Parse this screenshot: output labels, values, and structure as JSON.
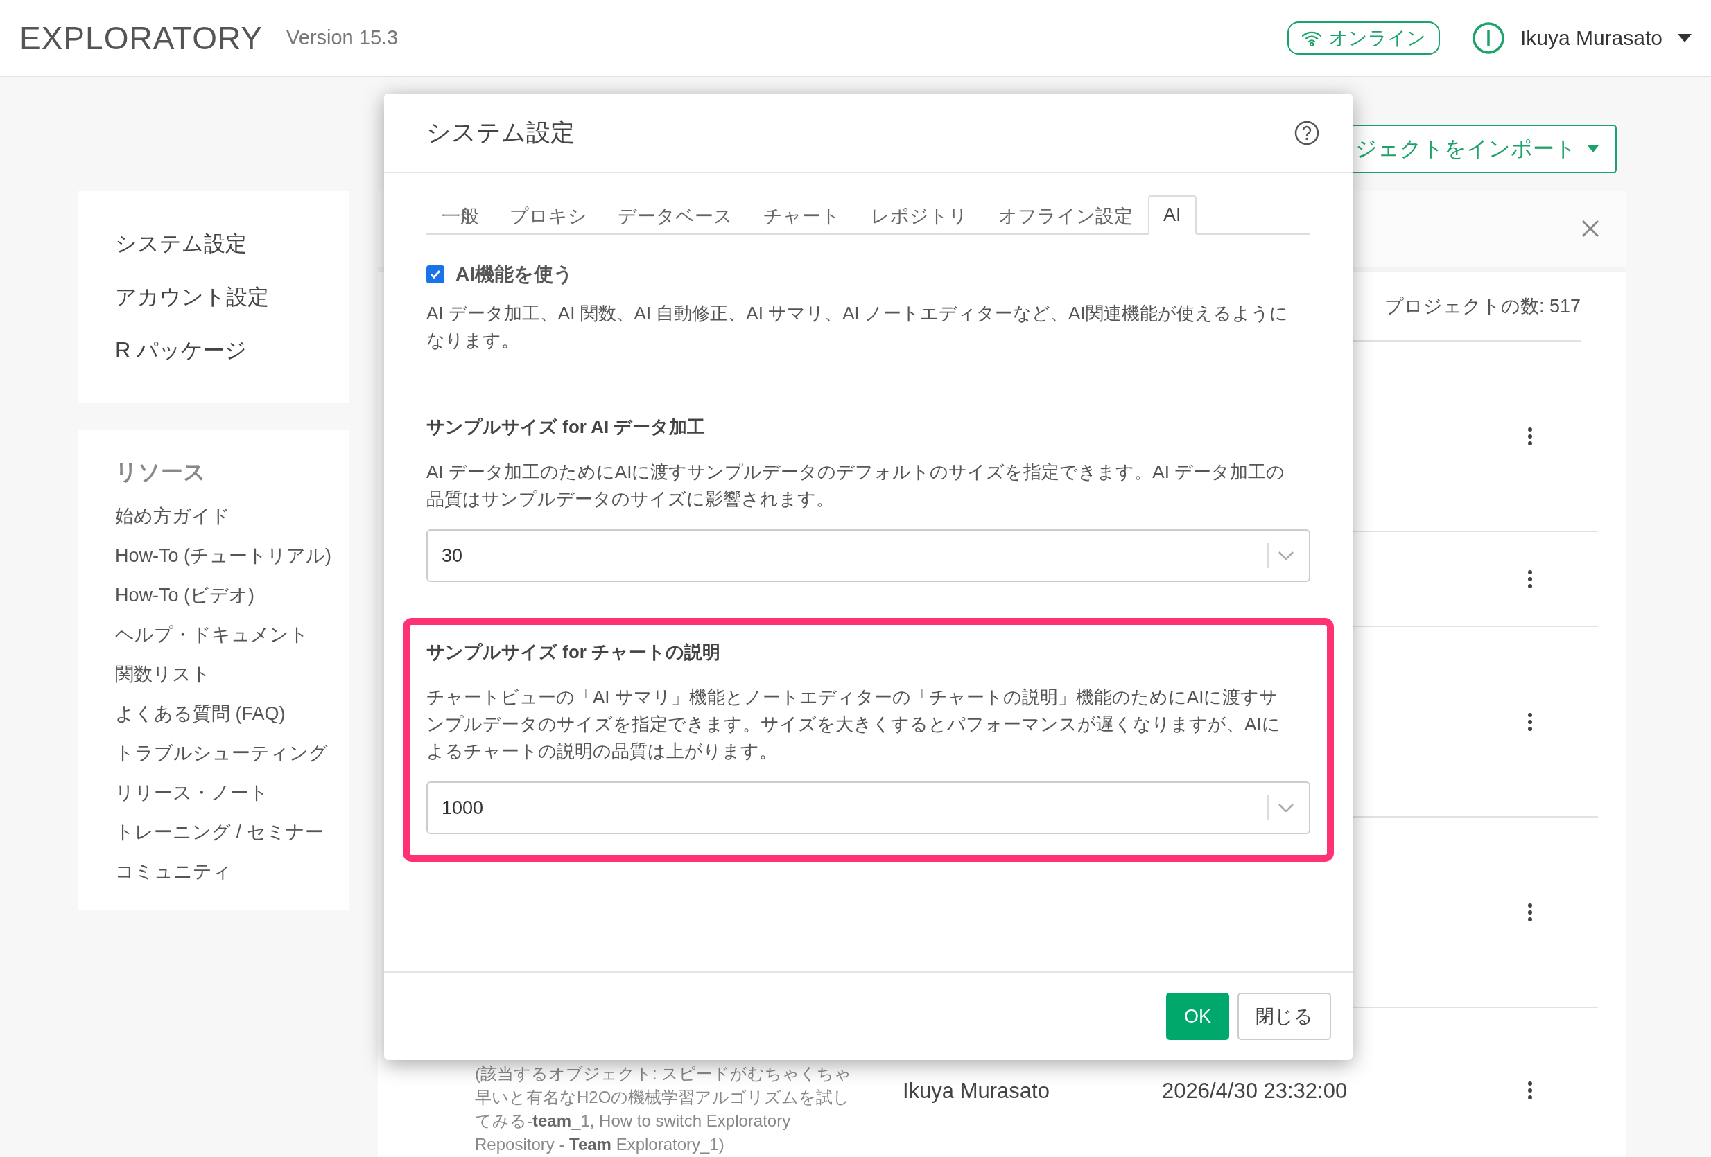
{
  "header": {
    "logo": "EXPLORATORY",
    "version": "Version 15.3",
    "status": "オンライン",
    "user": "Ikuya Murasato"
  },
  "sidebar": {
    "settings": [
      "システム設定",
      "アカウント設定",
      "R パッケージ"
    ],
    "resources": {
      "title": "リソース",
      "items": [
        "始め方ガイド",
        "How-To (チュートリアル)",
        "How-To (ビデオ)",
        "ヘルプ・ドキュメント",
        "関数リスト",
        "よくある質問 (FAQ)",
        "トラブルシューティング",
        "リリース・ノート",
        "トレーニング / セミナー",
        "コミュニティ"
      ]
    }
  },
  "projects": {
    "import_button": "ジェクトをインポート",
    "count": "プロジェクトの数: 517",
    "rows": [
      {
        "kind": "blank"
      },
      {
        "kind": "blank"
      },
      {
        "kind": "blank"
      },
      {
        "kind": "blank"
      },
      {
        "kind": "full",
        "description": "(該当するオブジェクト: スピードがむちゃくちゃ早いと有名なH2Oの機械学習アルゴリズムを試してみる-**team**_1, How to switch Exploratory Repository - **Team** Exploratory_1)",
        "author": "Ikuya Murasato",
        "updated": "2026/4/30 23:32:00"
      }
    ]
  },
  "dialog": {
    "title": "システム設定",
    "tabs": [
      {
        "label": "一般",
        "selected": false
      },
      {
        "label": "プロキシ",
        "selected": false
      },
      {
        "label": "データベース",
        "selected": false
      },
      {
        "label": "チャート",
        "selected": false
      },
      {
        "label": "レポジトリ",
        "selected": false
      },
      {
        "label": "オフライン設定",
        "selected": false
      },
      {
        "label": "AI",
        "selected": true
      }
    ],
    "ai_toggle": {
      "label": "AI機能を使う",
      "checked": true
    },
    "ai_description": "AI データ加工、AI 関数、AI 自動修正、AI サマリ、AI ノートエディターなど、AI関連機能が使えるようになります。",
    "sections": [
      {
        "heading": "サンプルサイズ for AI データ加工",
        "description": "AI データ加工のためにAIに渡すサンプルデータのデフォルトのサイズを指定できます。AI データ加工の品質はサンプルデータのサイズに影響されます。",
        "value": "30",
        "highlighted": false
      },
      {
        "heading": "サンプルサイズ for チャートの説明",
        "description": "チャートビューの「AI サマリ」機能とノートエディターの「チャートの説明」機能のためにAIに渡すサンプルデータのサイズを指定できます。サイズを大きくするとパフォーマンスが遅くなりますが、AIによるチャートの説明の品質は上がります。",
        "value": "1000",
        "highlighted": true
      }
    ],
    "buttons": [
      {
        "label": "OK",
        "kind": "primary"
      },
      {
        "label": "閉じる",
        "kind": "default"
      }
    ]
  }
}
